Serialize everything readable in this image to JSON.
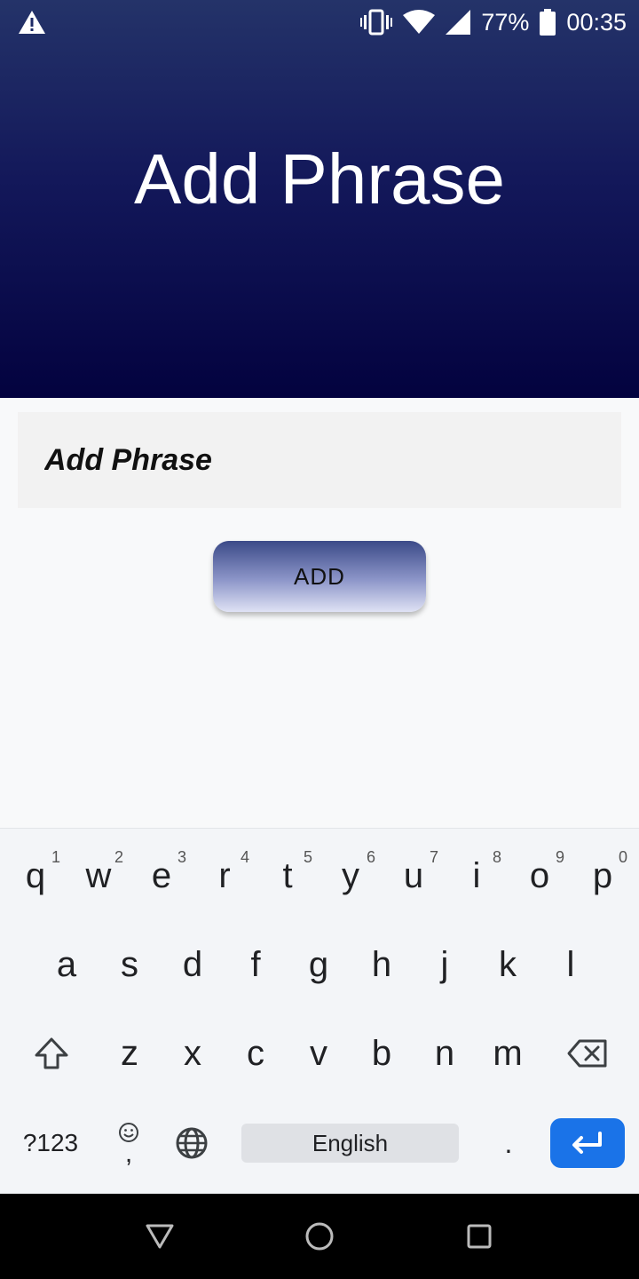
{
  "status_bar": {
    "battery_percent": "77%",
    "time": "00:35",
    "icons": [
      "alert-icon",
      "vibrate-icon",
      "wifi-icon",
      "signal-icon",
      "battery-icon"
    ]
  },
  "header": {
    "title": "Add Phrase",
    "gradient_top": "#243369",
    "gradient_bottom": "#03023f"
  },
  "form": {
    "phrase_placeholder": "Add Phrase",
    "phrase_value": "",
    "add_label": "ADD"
  },
  "keyboard": {
    "row1": [
      {
        "key": "q",
        "hint": "1"
      },
      {
        "key": "w",
        "hint": "2"
      },
      {
        "key": "e",
        "hint": "3"
      },
      {
        "key": "r",
        "hint": "4"
      },
      {
        "key": "t",
        "hint": "5"
      },
      {
        "key": "y",
        "hint": "6"
      },
      {
        "key": "u",
        "hint": "7"
      },
      {
        "key": "i",
        "hint": "8"
      },
      {
        "key": "o",
        "hint": "9"
      },
      {
        "key": "p",
        "hint": "0"
      }
    ],
    "row2": [
      "a",
      "s",
      "d",
      "f",
      "g",
      "h",
      "j",
      "k",
      "l"
    ],
    "row3": [
      "z",
      "x",
      "c",
      "v",
      "b",
      "n",
      "m"
    ],
    "symbols_label": "?123",
    "comma_label": ",",
    "space_label": "English",
    "period_label": ".",
    "accent_color": "#1a73e8"
  },
  "nav_bar": {
    "icons": [
      "back-icon",
      "home-icon",
      "recents-icon"
    ]
  }
}
